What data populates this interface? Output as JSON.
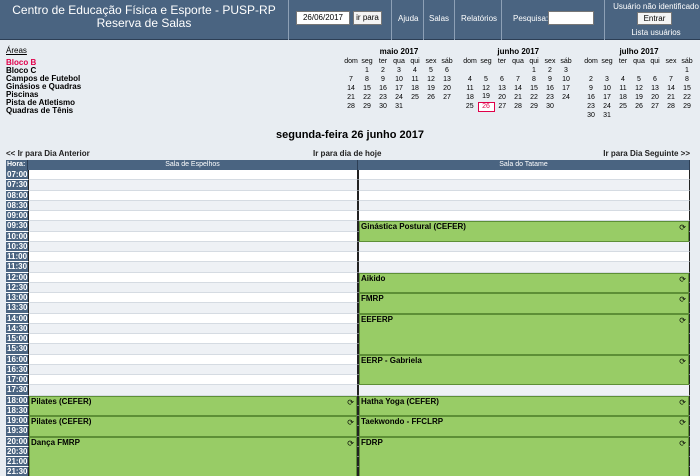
{
  "header": {
    "title_line1": "Centro de Educação Física e Esporte - PUSP-RP",
    "title_line2": "Reserva de Salas",
    "date_value": "26/06/2017",
    "go_label": "ir para",
    "nav": [
      "Ajuda",
      "Salas",
      "Relatórios"
    ],
    "search_label": "Pesquisa:",
    "search_value": "",
    "user_status": "Usuário não identificado",
    "login_label": "Entrar",
    "users_link": "Lista usuários"
  },
  "areas": {
    "heading": "Áreas",
    "items": [
      "Bloco B",
      "Bloco C",
      "Campos de Futebol",
      "Ginásios e Quadras",
      "Piscinas",
      "Pista de Atletismo",
      "Quadras de Tênis"
    ],
    "current_index": 0
  },
  "calendars": [
    {
      "title": "maio 2017",
      "headers": [
        "dom",
        "seg",
        "ter",
        "qua",
        "qui",
        "sex",
        "sáb"
      ],
      "weeks": [
        [
          "",
          "1",
          "2",
          "3",
          "4",
          "5",
          "6"
        ],
        [
          "7",
          "8",
          "9",
          "10",
          "11",
          "12",
          "13"
        ],
        [
          "14",
          "15",
          "16",
          "17",
          "18",
          "19",
          "20"
        ],
        [
          "21",
          "22",
          "23",
          "24",
          "25",
          "26",
          "27"
        ],
        [
          "28",
          "29",
          "30",
          "31",
          "",
          "",
          ""
        ]
      ]
    },
    {
      "title": "junho 2017",
      "headers": [
        "dom",
        "seg",
        "ter",
        "qua",
        "qui",
        "sex",
        "sáb"
      ],
      "weeks": [
        [
          "",
          "",
          "",
          "",
          "1",
          "2",
          "3"
        ],
        [
          "4",
          "5",
          "6",
          "7",
          "8",
          "9",
          "10"
        ],
        [
          "11",
          "12",
          "13",
          "14",
          "15",
          "16",
          "17"
        ],
        [
          "18",
          "19",
          "20",
          "21",
          "22",
          "23",
          "24"
        ],
        [
          "25",
          "26",
          "27",
          "28",
          "29",
          "30",
          ""
        ]
      ],
      "today": "26"
    },
    {
      "title": "julho 2017",
      "headers": [
        "dom",
        "seg",
        "ter",
        "qua",
        "qui",
        "sex",
        "sáb"
      ],
      "weeks": [
        [
          "",
          "",
          "",
          "",
          "",
          "",
          "1"
        ],
        [
          "2",
          "3",
          "4",
          "5",
          "6",
          "7",
          "8"
        ],
        [
          "9",
          "10",
          "11",
          "12",
          "13",
          "14",
          "15"
        ],
        [
          "16",
          "17",
          "18",
          "19",
          "20",
          "21",
          "22"
        ],
        [
          "23",
          "24",
          "25",
          "26",
          "27",
          "28",
          "29"
        ],
        [
          "30",
          "31",
          "",
          "",
          "",
          "",
          ""
        ]
      ]
    }
  ],
  "day_title": "segunda-feira 26 junho 2017",
  "nav": {
    "prev": "<< Ir para Dia Anterior",
    "today": "Ir para dia de hoje",
    "next": "Ir para Dia Seguinte >>"
  },
  "grid": {
    "hour_header": "Hora:",
    "rooms": [
      "Sala de Espelhos",
      "Sala do Tatame"
    ],
    "times": [
      "07:00",
      "07:30",
      "08:00",
      "08:30",
      "09:00",
      "09:30",
      "10:00",
      "10:30",
      "11:00",
      "11:30",
      "12:00",
      "12:30",
      "13:00",
      "13:30",
      "14:00",
      "14:30",
      "15:00",
      "15:30",
      "16:00",
      "16:30",
      "17:00",
      "17:30",
      "18:00",
      "18:30",
      "19:00",
      "19:30",
      "20:00",
      "20:30",
      "21:00",
      "21:30"
    ],
    "bookings": [
      {
        "room": 1,
        "start": 5,
        "span": 2,
        "label": "Ginástica Postural (CEFER)"
      },
      {
        "room": 1,
        "start": 10,
        "span": 2,
        "label": "Aikido"
      },
      {
        "room": 1,
        "start": 12,
        "span": 2,
        "label": "FMRP"
      },
      {
        "room": 1,
        "start": 14,
        "span": 4,
        "label": "EEFERP"
      },
      {
        "room": 1,
        "start": 18,
        "span": 3,
        "label": "EERP - Gabriela"
      },
      {
        "room": 0,
        "start": 22,
        "span": 2,
        "label": "Pilates (CEFER)"
      },
      {
        "room": 0,
        "start": 24,
        "span": 2,
        "label": "Pilates (CEFER)"
      },
      {
        "room": 0,
        "start": 26,
        "span": 4,
        "label": "Dança FMRP"
      },
      {
        "room": 1,
        "start": 22,
        "span": 2,
        "label": "Hatha Yoga (CEFER)"
      },
      {
        "room": 1,
        "start": 24,
        "span": 2,
        "label": "Taekwondo - FFCLRP"
      },
      {
        "room": 1,
        "start": 26,
        "span": 4,
        "label": "FDRP"
      }
    ],
    "repeat_icon": "repeat-icon"
  }
}
